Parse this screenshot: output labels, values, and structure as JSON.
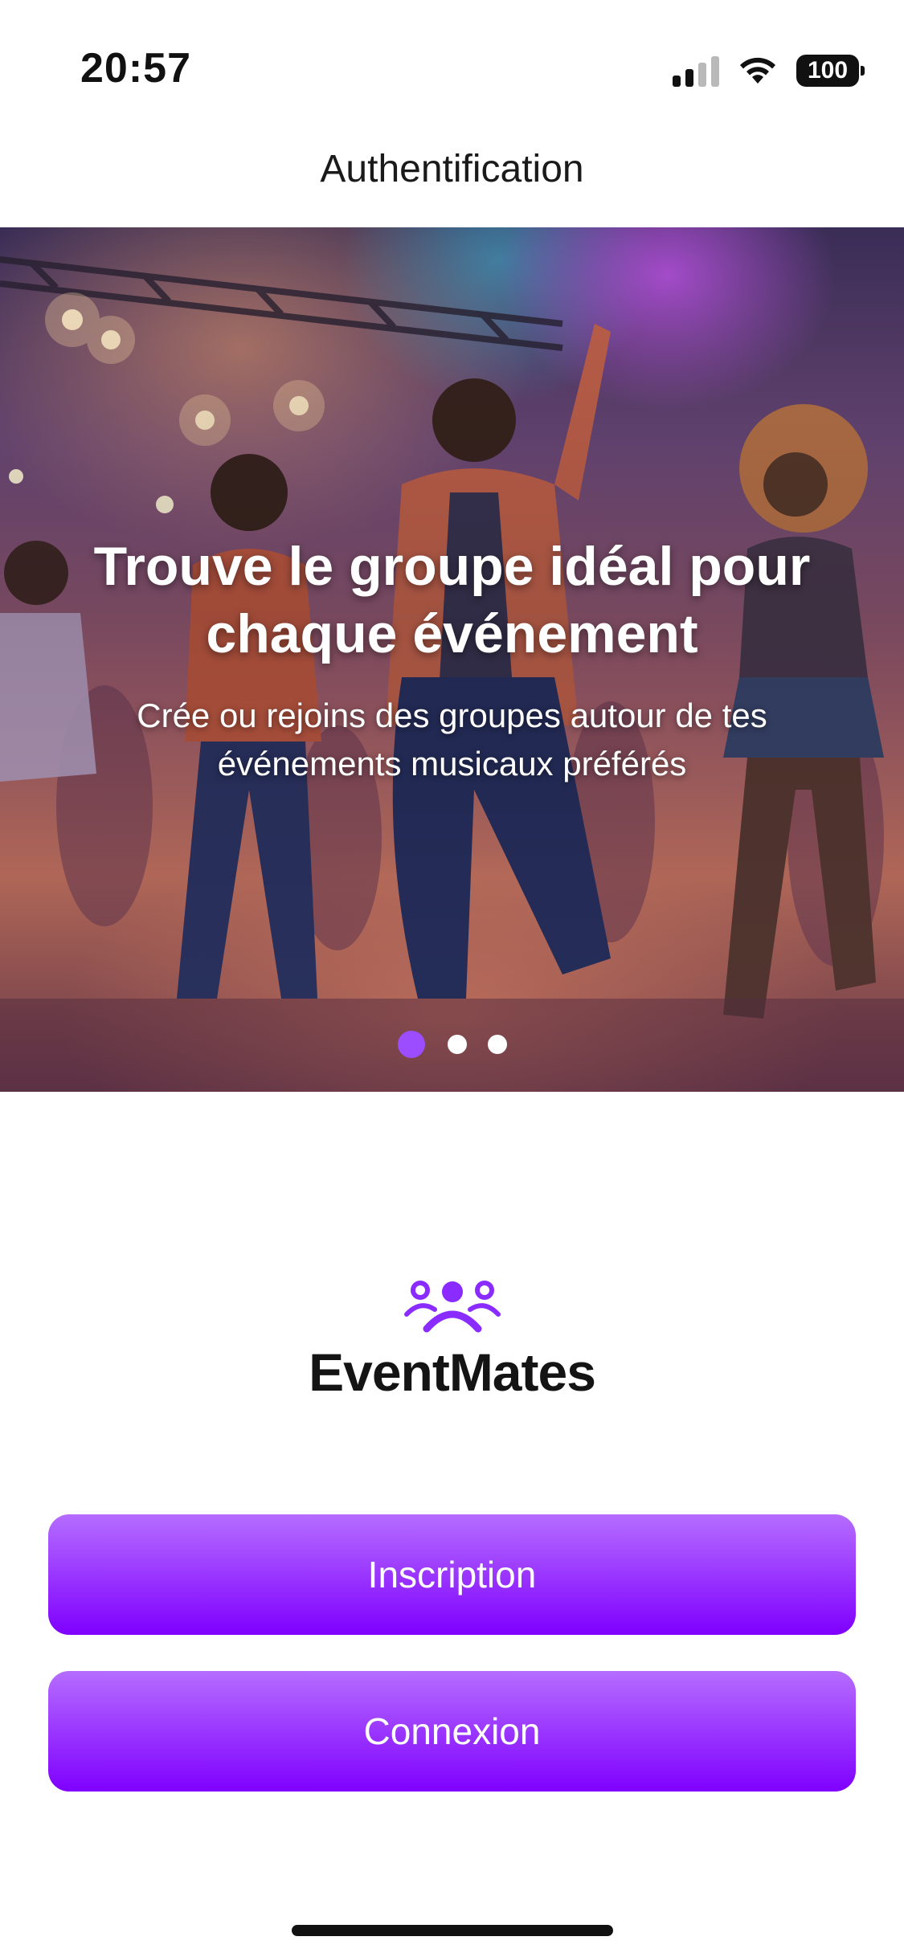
{
  "status_bar": {
    "time": "20:57",
    "battery": "100",
    "icons": [
      "signal-icon",
      "wifi-icon",
      "battery-icon"
    ]
  },
  "nav": {
    "title": "Authentification"
  },
  "hero": {
    "title": "Trouve le groupe idéal pour chaque événement",
    "subtitle": "Crée ou rejoins des groupes autour de tes événements musicaux préférés",
    "carousel": {
      "count": 3,
      "active_index": 0
    }
  },
  "brand": {
    "name": "EventMates",
    "icon": "group-people-icon"
  },
  "actions": {
    "signup_label": "Inscription",
    "login_label": "Connexion"
  },
  "colors": {
    "accent": "#8a2cff",
    "accent_light": "#b56dff",
    "dot_active": "#9b4dff",
    "text_dark": "#141414"
  }
}
